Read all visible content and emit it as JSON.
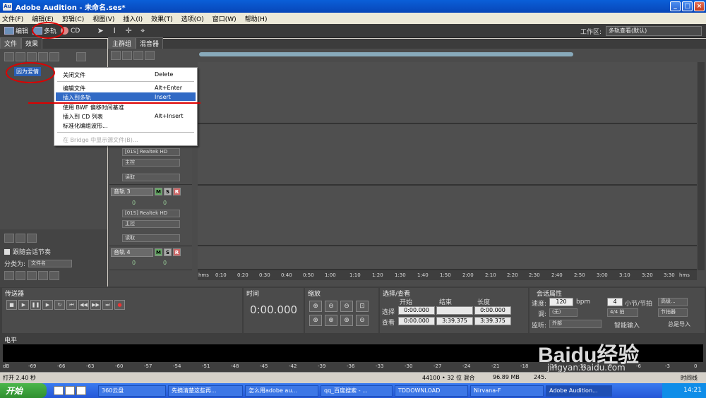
{
  "window": {
    "title": "Adobe Audition - 未命名.ses*"
  },
  "menu": [
    "文件(F)",
    "编辑(E)",
    "剪辑(C)",
    "视图(V)",
    "插入(I)",
    "效果(T)",
    "选项(O)",
    "窗口(W)",
    "帮助(H)"
  ],
  "toolbar": {
    "edit_label": "编辑",
    "multitrack_label": "多轨",
    "cd_label": "CD",
    "workspace_label": "工作区:",
    "workspace_value": "多轨查看(默认)"
  },
  "files_panel": {
    "tab_files": "文件",
    "tab_effects": "效果",
    "file_item": "因为爱情",
    "follow_label": "跟随会话节奏",
    "sort_label": "分类为:",
    "sort_value": "文件名"
  },
  "main_panel": {
    "tab_main": "主群组",
    "tab_mixer": "混音器"
  },
  "tracks": [
    {
      "name": "音轨 3",
      "device": "[01S] Realtek HD",
      "bus": "主控",
      "mode": "读取",
      "volume": "0",
      "pan": "0"
    },
    {
      "name": "音轨 4",
      "device": "",
      "bus": "",
      "mode": "",
      "volume": "0",
      "pan": "0"
    }
  ],
  "track2": {
    "device": "[01S] Realtek HD",
    "bus": "主控",
    "mode": "读取"
  },
  "ruler": [
    "hms",
    "0:10",
    "0:20",
    "0:30",
    "0:40",
    "0:50",
    "1:00",
    "1:10",
    "1:20",
    "1:30",
    "1:40",
    "1:50",
    "2:00",
    "2:10",
    "2:20",
    "2:30",
    "2:40",
    "2:50",
    "3:00",
    "3:10",
    "3:20",
    "3:30",
    "hms"
  ],
  "context_menu": [
    {
      "label": "关闭文件",
      "shortcut": "Delete"
    },
    {
      "label": "编辑文件",
      "shortcut": "Alt+Enter"
    },
    {
      "label": "插入到多轨",
      "shortcut": "Insert"
    },
    {
      "label": "使用 BWF 偏移时间基准",
      "shortcut": ""
    },
    {
      "label": "插入到 CD 列表",
      "shortcut": "Alt+Insert"
    },
    {
      "label": "标准化编组波形...",
      "shortcut": ""
    },
    {
      "label": "在 Bridge 中显示源文件(B)...",
      "shortcut": ""
    }
  ],
  "bottom": {
    "transport_title": "传送器",
    "time_title": "时间",
    "time_value": "0:00.000",
    "zoom_title": "缩放",
    "selection_title": "选择/查看",
    "sel_headers": [
      "开始",
      "结束",
      "长度"
    ],
    "sel_row_label": "选择",
    "view_row_label": "查看",
    "sel_start": "0:00.000",
    "sel_end": "",
    "sel_length": "0:00.000",
    "view_start": "0:00.000",
    "view_end": "3:39.375",
    "view_length": "3:39.375",
    "session_title": "会话属性",
    "tempo_label": "速度:",
    "tempo_value": "120",
    "tempo_unit": "bpm",
    "beats_value": "4",
    "beats_unit": "小节/节拍",
    "advanced_button": "高级...",
    "key_label": "调:",
    "key_value": "(无)",
    "time_sig_value": "4/4 拍",
    "metronome_button": "节拍器",
    "monitor_label": "监听:",
    "monitor_value": "外部",
    "smart_input": "智能输入",
    "always_input": "总是导入"
  },
  "levels": {
    "title": "电平",
    "scale": [
      "dB",
      "-69",
      "-66",
      "-63",
      "-60",
      "-57",
      "-54",
      "-51",
      "-48",
      "-45",
      "-42",
      "-39",
      "-36",
      "-33",
      "-30",
      "-27",
      "-24",
      "-21",
      "-18",
      "-15",
      "-12",
      "-9",
      "-6",
      "-3",
      "0"
    ]
  },
  "status": {
    "left": "打开 2.40 秒",
    "format": "44100 • 32 位 混合",
    "mem": "96.89 MB",
    "disk": "245.",
    "timecode": "时间线"
  },
  "taskbar": {
    "start": "开始",
    "items": [
      "360云盘",
      "先摘清楚这些再...",
      "怎么用adobe au...",
      "qq_百度搜索 - ...",
      "TDDOWNLOAD",
      "Nirvana-F",
      "Adobe Audition..."
    ],
    "clock": "14:21"
  },
  "watermark": "Baidu经验",
  "watermark_url": "jingyan.baidu.com"
}
